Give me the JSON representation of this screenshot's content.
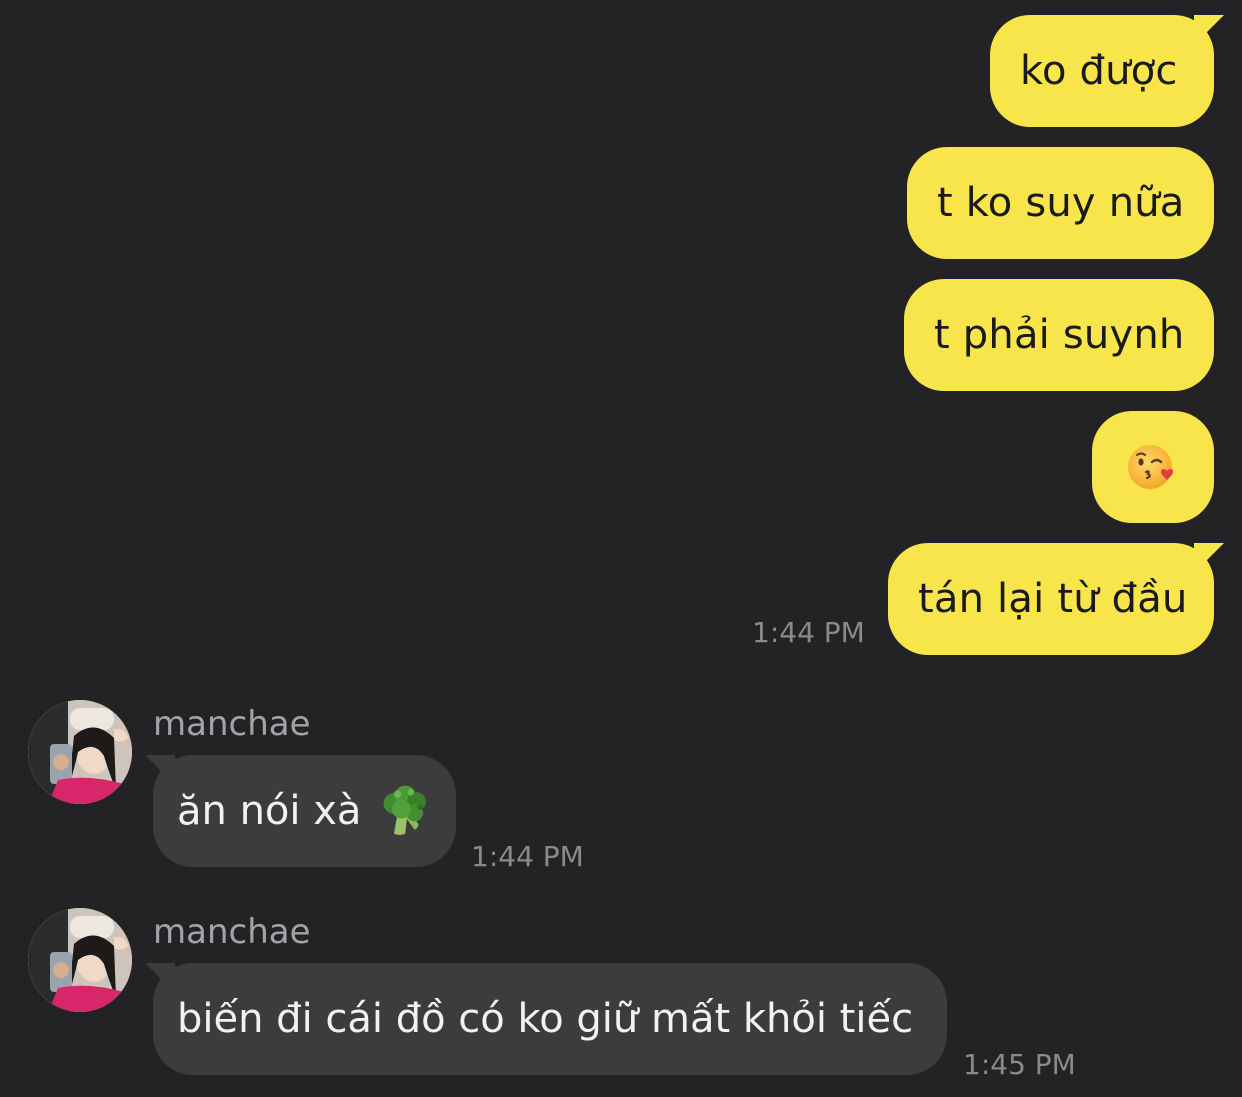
{
  "outgoing": [
    {
      "text": "ko được"
    },
    {
      "text": "t ko suy nữa"
    },
    {
      "text": "t phải suynh"
    },
    {
      "emoji": "kiss-wink-heart-emoji"
    },
    {
      "text": "tán lại từ đầu"
    }
  ],
  "outgoing_timestamp": "1:44 PM",
  "incoming": [
    {
      "sender": "manchae",
      "text": "ăn nói xà",
      "emoji": "broccoli-emoji",
      "timestamp": "1:44 PM"
    },
    {
      "sender": "manchae",
      "text": "biến đi cái đồ có ko giữ mất khỏi tiếc",
      "timestamp": "1:45 PM"
    }
  ],
  "colors": {
    "background": "#232325",
    "outgoing_bubble": "#f7e54b",
    "incoming_bubble": "#3c3c3f",
    "timestamp": "#8a8a8d",
    "sender_name": "#a4a4a8"
  }
}
